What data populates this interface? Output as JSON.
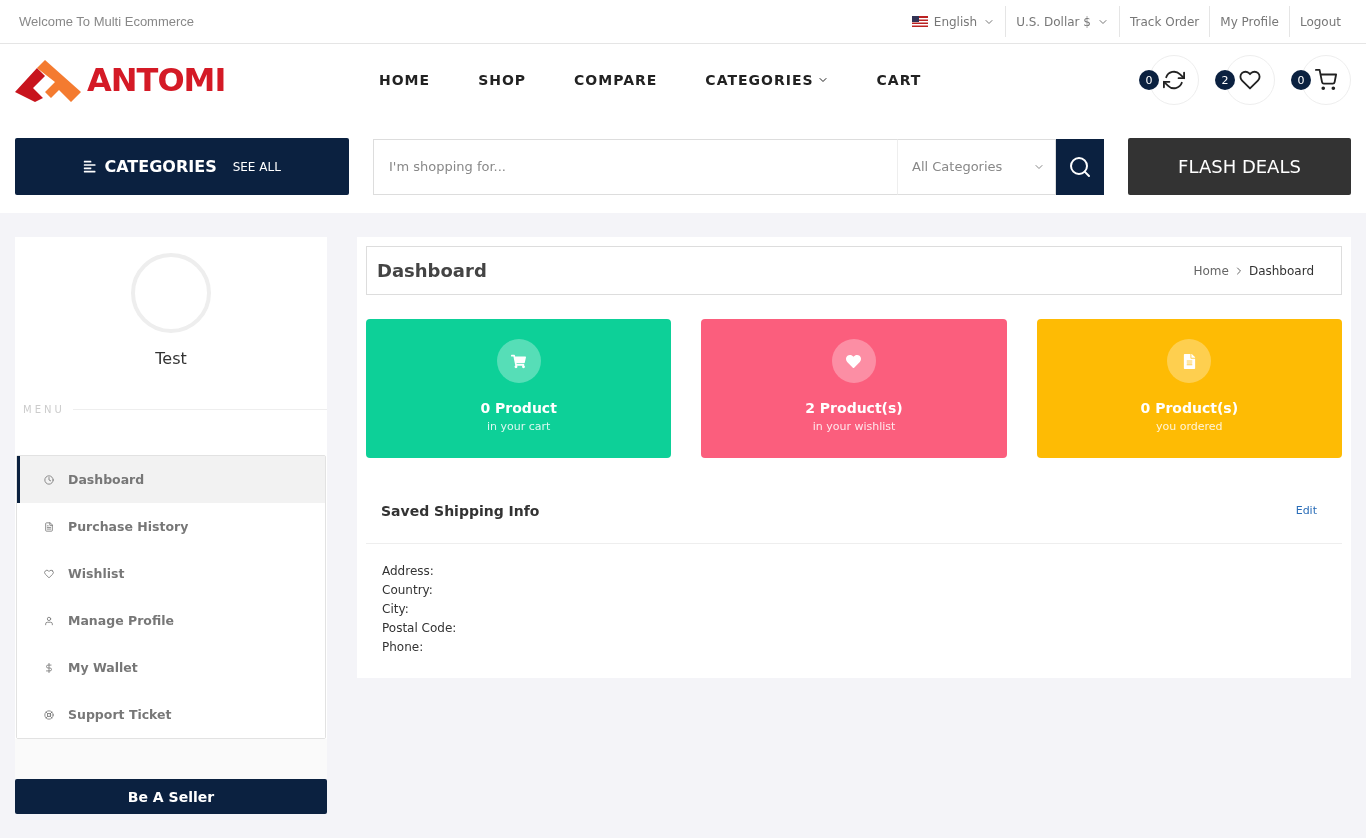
{
  "top_bar": {
    "welcome": "Welcome To Multi Ecommerce",
    "language": "English",
    "currency": "U.S. Dollar $",
    "links": [
      "Track Order",
      "My Profile",
      "Logout"
    ]
  },
  "header": {
    "logo": "ANTOMI",
    "nav": [
      {
        "label": "HOME",
        "dropdown": false
      },
      {
        "label": "SHOP",
        "dropdown": false
      },
      {
        "label": "COMPARE",
        "dropdown": false
      },
      {
        "label": "CATEGORIES",
        "dropdown": true
      },
      {
        "label": "CART",
        "dropdown": false
      }
    ],
    "counters": [
      {
        "kind": "compare",
        "count": "0"
      },
      {
        "kind": "wishlist",
        "count": "2"
      },
      {
        "kind": "cart",
        "count": "0"
      }
    ]
  },
  "search_row": {
    "categories_title": "CATEGORIES",
    "see_all": "SEE ALL",
    "placeholder": "I'm shopping for...",
    "category_select": "All Categories",
    "flash_deals": "FLASH DEALS"
  },
  "sidebar": {
    "user_name": "Test",
    "menu_label": "MENU",
    "items": [
      {
        "label": "Dashboard",
        "kind": "dashboard",
        "selected": true
      },
      {
        "label": "Purchase History",
        "kind": "history",
        "selected": false
      },
      {
        "label": "Wishlist",
        "kind": "wishlist",
        "selected": false
      },
      {
        "label": "Manage Profile",
        "kind": "profile",
        "selected": false
      },
      {
        "label": "My Wallet",
        "kind": "wallet",
        "selected": false
      },
      {
        "label": "Support Ticket",
        "kind": "support",
        "selected": false
      }
    ],
    "seller_button": "Be A Seller"
  },
  "content": {
    "title": "Dashboard",
    "breadcrumb": [
      "Home",
      "Dashboard"
    ],
    "stats": [
      {
        "kind": "cart",
        "color": "#0dd098",
        "value": "0 Product",
        "caption": "in your cart"
      },
      {
        "kind": "wishlist",
        "color": "#fb5e7d",
        "value": "2 Product(s)",
        "caption": "in your wishlist"
      },
      {
        "kind": "orders",
        "color": "#febb04",
        "value": "0 Product(s)",
        "caption": "you ordered"
      }
    ],
    "shipping": {
      "title": "Saved Shipping Info",
      "edit": "Edit",
      "fields": [
        "Address:",
        "Country:",
        "City:",
        "Postal Code:",
        "Phone:"
      ]
    }
  }
}
